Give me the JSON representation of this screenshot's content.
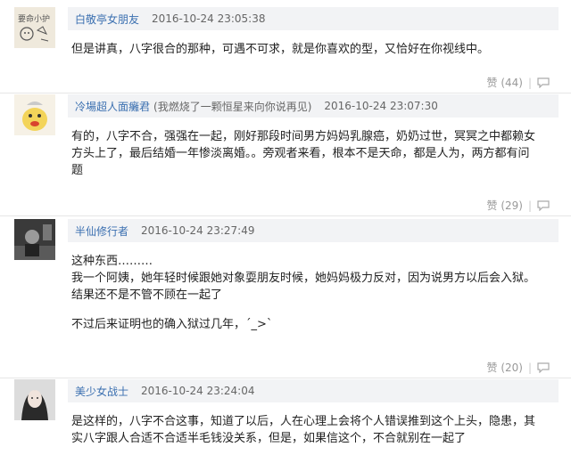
{
  "comments": [
    {
      "user": "白敬亭女朋友",
      "signature": "",
      "time": "2016-10-24 23:05:38",
      "lines": [
        "但是讲真，八字很合的那种，可遇不可求，就是你喜欢的型，又恰好在你视线中。"
      ],
      "likes": "赞 (44)"
    },
    {
      "user": "冷場超人面癱君",
      "signature": "(我燃烧了一颗恒星来向你说再见)",
      "time": "2016-10-24 23:07:30",
      "lines": [
        "有的，八字不合，强强在一起，刚好那段时间男方妈妈乳腺癌，奶奶过世，冥冥之中都赖女",
        "方头上了，最后结婚一年惨淡离婚。。旁观者来看，根本不是天命，都是人为，两方都有问",
        "题"
      ],
      "likes": "赞 (29)"
    },
    {
      "user": "半仙修行者",
      "signature": "",
      "time": "2016-10-24 23:27:49",
      "lines": [
        "这种东西………",
        "我一个阿姨，她年轻时候跟她对象耍朋友时候，她妈妈极力反对，因为说男方以后会入狱。",
        "结果还不是不管不顾在一起了",
        "",
        "不过后来证明也的确入狱过几年，´_>`"
      ],
      "likes": "赞 (20)"
    },
    {
      "user": "美少女战士",
      "signature": "",
      "time": "2016-10-24 23:24:04",
      "lines": [
        "是这样的，八字不合这事，知道了以后，人在心理上会将个人错误推到这个上头，隐患，其",
        "实八字跟人合适不合适半毛钱没关系，但是，如果信这个，不合就别在一起了"
      ],
      "likes": ""
    }
  ]
}
